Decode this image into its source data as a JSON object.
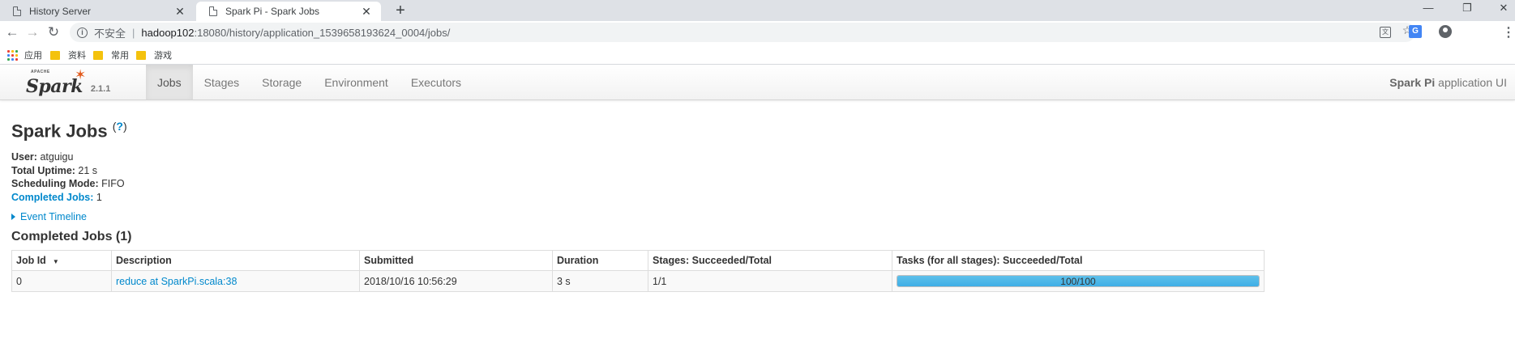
{
  "browser": {
    "tabs": [
      {
        "title": "History Server",
        "active": false
      },
      {
        "title": "Spark Pi - Spark Jobs",
        "active": true
      }
    ],
    "address": {
      "security_label": "不安全",
      "host": "hadoop102",
      "path": ":18080/history/application_1539658193624_0004/jobs/"
    },
    "bookmarks": [
      {
        "label": "应用",
        "icon": "apps-icon"
      },
      {
        "label": "资料",
        "icon": "folder-icon"
      },
      {
        "label": "常用",
        "icon": "folder-icon"
      },
      {
        "label": "游戏",
        "icon": "folder-icon"
      }
    ]
  },
  "spark_nav": {
    "brand": "Spark",
    "brand_prefix": "APACHE",
    "version": "2.1.1",
    "links": [
      "Jobs",
      "Stages",
      "Storage",
      "Environment",
      "Executors"
    ],
    "active_link": "Jobs",
    "app_name": "Spark Pi",
    "app_suffix": "application UI"
  },
  "page": {
    "title": "Spark Jobs",
    "help": "?",
    "summary": {
      "user_label": "User:",
      "user": "atguigu",
      "uptime_label": "Total Uptime:",
      "uptime": "21 s",
      "scheduling_label": "Scheduling Mode:",
      "scheduling": "FIFO",
      "completed_label": "Completed Jobs:",
      "completed": "1"
    },
    "event_timeline": "Event Timeline",
    "completed_section": "Completed Jobs (1)"
  },
  "jobs_table": {
    "columns": [
      "Job Id",
      "Description",
      "Submitted",
      "Duration",
      "Stages: Succeeded/Total",
      "Tasks (for all stages): Succeeded/Total"
    ],
    "rows": [
      {
        "job_id": "0",
        "description": "reduce at SparkPi.scala:38",
        "submitted": "2018/10/16 10:56:29",
        "duration": "3 s",
        "stages": "1/1",
        "tasks": "100/100",
        "tasks_progress": 1.0
      }
    ]
  },
  "colors": {
    "link": "#0088cc",
    "progress_bar": "#4aa8e0",
    "spark_orange": "#e25a1c"
  }
}
